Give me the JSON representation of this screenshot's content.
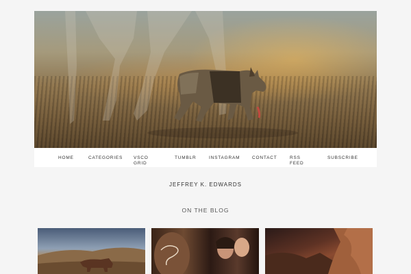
{
  "hero": {
    "image_icon": "dog-and-horse-photo"
  },
  "nav": {
    "items": [
      {
        "label": "HOME"
      },
      {
        "label": "CATEGORIES"
      },
      {
        "label_line1": "VSCO",
        "label_line2": "GRID"
      },
      {
        "label": "TUMBLR"
      },
      {
        "label": "INSTAGRAM"
      },
      {
        "label": "CONTACT"
      },
      {
        "label_line1": "RSS",
        "label_line2": "FEED"
      },
      {
        "label": "SUBSCRIBE"
      }
    ]
  },
  "author": "JEFFREY K. EDWARDS",
  "section_title": "ON THE BLOG",
  "blog_posts": [
    {
      "icon": "desert-horse-photo"
    },
    {
      "icon": "wine-label-couple-photo"
    },
    {
      "icon": "red-rock-canyon-photo"
    }
  ]
}
